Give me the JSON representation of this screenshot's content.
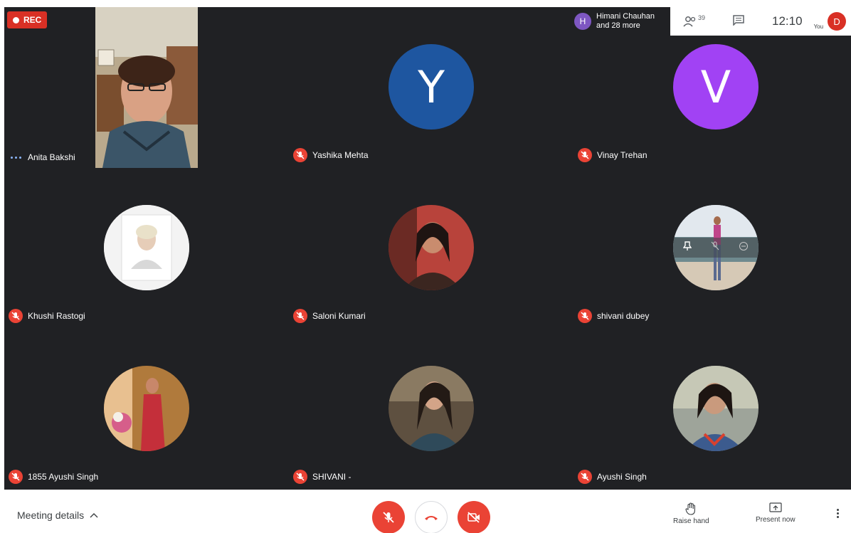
{
  "recording": {
    "label": "REC"
  },
  "header": {
    "presenter": {
      "initial": "H",
      "name": "Himani Chauhan",
      "more": "and 28 more"
    },
    "people_count": "39",
    "time": "12:10",
    "you_label": "You",
    "self_initial": "D"
  },
  "tiles": [
    {
      "name": "Anita Bakshi",
      "status": "speaking",
      "type": "video"
    },
    {
      "name": "Yashika Mehta",
      "status": "muted",
      "type": "letter",
      "initial": "Y",
      "color": "#1e56a0"
    },
    {
      "name": "Vinay Trehan",
      "status": "muted",
      "type": "letter",
      "initial": "V",
      "color": "#a142f4"
    },
    {
      "name": "Khushi Rastogi",
      "status": "muted",
      "type": "photo"
    },
    {
      "name": "Saloni Kumari",
      "status": "muted",
      "type": "photo"
    },
    {
      "name": "shivani dubey",
      "status": "muted",
      "type": "photo"
    },
    {
      "name": "1855 Ayushi Singh",
      "status": "muted",
      "type": "photo"
    },
    {
      "name": "SHIVANI -",
      "status": "muted",
      "type": "photo"
    },
    {
      "name": "Ayushi Singh",
      "status": "muted",
      "type": "photo"
    }
  ],
  "bottom": {
    "meeting_details": "Meeting details",
    "raise_hand": "Raise hand",
    "present_now": "Present now"
  },
  "colors": {
    "muted_red": "#ea4335",
    "grid_bg": "#202124",
    "accent_blue": "#8ab4f8"
  }
}
